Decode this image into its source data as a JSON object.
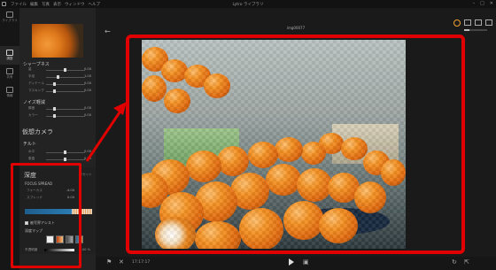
{
  "app": {
    "title": "Lytro ライブラリ",
    "menu": [
      "ファイル",
      "編集",
      "写真",
      "表示",
      "ウィンドウ",
      "ヘルプ"
    ]
  },
  "rail": [
    {
      "label": "ライブラリ",
      "icon": "library-icon",
      "active": false
    },
    {
      "label": "調整",
      "icon": "adjust-icon",
      "active": true
    },
    {
      "label": "共有",
      "icon": "share-icon",
      "active": false
    },
    {
      "label": "情報",
      "icon": "info-icon",
      "active": false
    }
  ],
  "panel": {
    "sharpness": {
      "heading": "シャープネス",
      "sliders": [
        {
          "label": "量",
          "value": "0.00",
          "level": 0.5
        },
        {
          "label": "半径",
          "value": "1.00",
          "level": 0.3
        },
        {
          "label": "ディテール",
          "value": "0.00",
          "level": 0.2
        },
        {
          "label": "マスキング",
          "value": "0.00",
          "level": 0.2
        }
      ]
    },
    "noise": {
      "heading": "ノイズ軽減",
      "sliders": [
        {
          "label": "輝度",
          "value": "0.00",
          "level": 0.2
        },
        {
          "label": "カラー",
          "value": "0.00",
          "level": 0.2
        }
      ]
    },
    "virtual_camera": {
      "heading": "仮想カメラ",
      "tilt": "チルト",
      "sliders": [
        {
          "label": "水平",
          "value": "0.00",
          "level": 0.5
        },
        {
          "label": "垂直",
          "value": "0.00",
          "level": 0.5
        }
      ]
    },
    "depth": {
      "heading": "深度",
      "reset": "リセット",
      "focus_spread": "FOCUS SPREAD",
      "sliders": [
        {
          "label": "フォーカス",
          "value": "-4.00",
          "level": 0.4
        },
        {
          "label": "スプレッド",
          "value": "0.00",
          "level": 0.3
        }
      ],
      "checkbox_label": "被写界アシスト",
      "depth_map": "深度マップ",
      "gradient_label": "不透明度",
      "gradient_value": "100 %"
    }
  },
  "viewer": {
    "filename": "img00077",
    "back": "←"
  },
  "bottom": {
    "time": "17:17:17"
  },
  "colors": {
    "highlight": "#e00000",
    "accent": "#f0a030"
  }
}
